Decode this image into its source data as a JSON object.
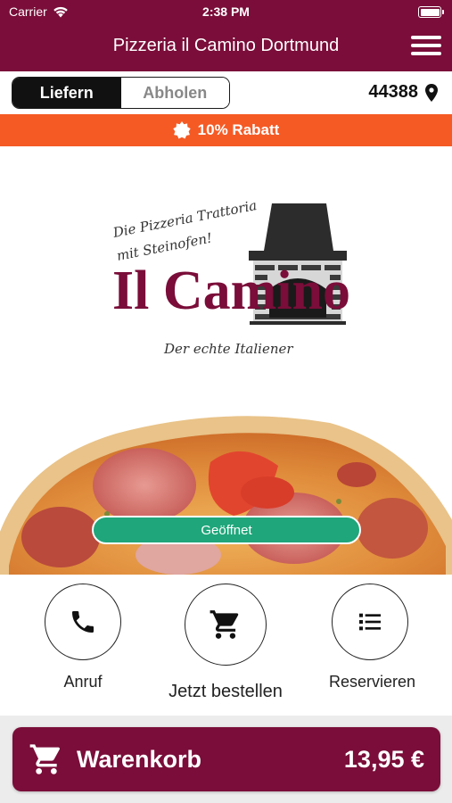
{
  "status_bar": {
    "carrier": "Carrier",
    "time": "2:38 PM"
  },
  "header": {
    "title": "Pizzeria il Camino Dortmund"
  },
  "order_mode": {
    "deliver_label": "Liefern",
    "pickup_label": "Abholen",
    "selected": "Liefern"
  },
  "location": {
    "zip": "44388"
  },
  "promo": {
    "label": "10% Rabatt"
  },
  "logo": {
    "tagline_line1": "Die Pizzeria Trattoria",
    "tagline_line2": "mit Steinofen!",
    "name": "Il Camino",
    "slogan": "Der echte Italiener"
  },
  "status": {
    "open_label": "Geöffnet",
    "open_color": "#1fa67a"
  },
  "actions": {
    "call_label": "Anruf",
    "order_label": "Jetzt bestellen",
    "reserve_label": "Reservieren"
  },
  "cart": {
    "label": "Warenkorb",
    "total": "13,95 €"
  },
  "colors": {
    "brand": "#7a0d39",
    "promo": "#f55a25",
    "open": "#1fa67a"
  }
}
